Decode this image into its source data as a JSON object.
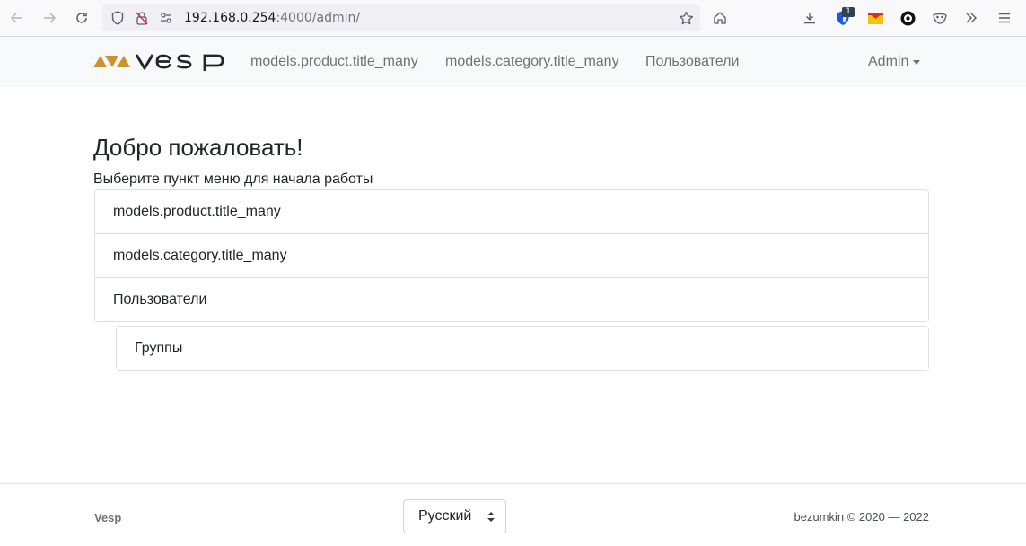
{
  "browser": {
    "url_host": "192.168.0.254",
    "url_path": ":4000/admin/",
    "extension_badge": "1"
  },
  "navbar": {
    "brand_text": "VESP",
    "links": [
      {
        "label": "models.product.title_many"
      },
      {
        "label": "models.category.title_many"
      },
      {
        "label": "Пользователи"
      }
    ],
    "admin_label": "Admin"
  },
  "main": {
    "title": "Добро пожаловать!",
    "subtitle": "Выберите пункт меню для начала работы",
    "menu": [
      {
        "label": "models.product.title_many"
      },
      {
        "label": "models.category.title_many"
      },
      {
        "label": "Пользователи"
      }
    ],
    "submenu": [
      {
        "label": "Группы"
      }
    ]
  },
  "footer": {
    "brand": "Vesp",
    "language": "Русский",
    "copyright": "bezumkin © 2020 — 2022"
  },
  "colors": {
    "brand_gold": "#c9932e",
    "navbar_bg": "#f8f9fa"
  }
}
